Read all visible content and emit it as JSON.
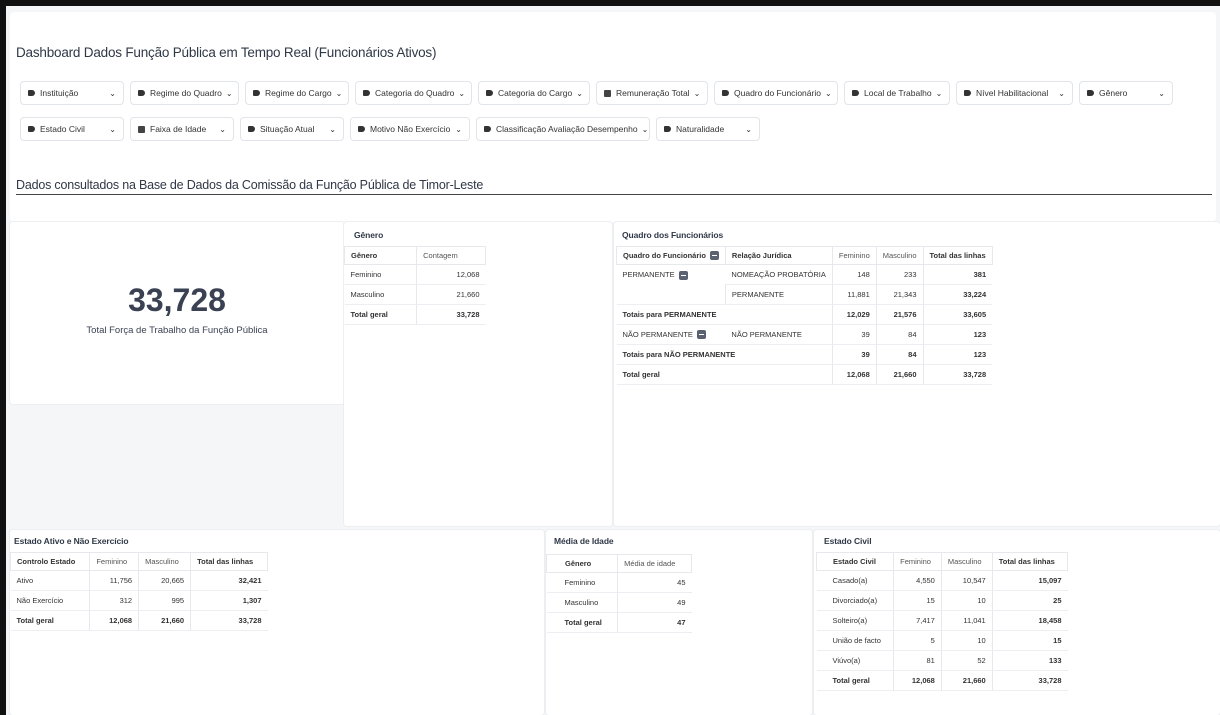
{
  "header": {
    "title": "Dashboard Dados Função Pública em Tempo Real (Funcionários Ativos)",
    "section_title": "Dados consultados na Base de Dados da Comissão da Função Pública de Timor-Leste"
  },
  "filters": [
    {
      "label": "Instituição",
      "icon": "tag-icon"
    },
    {
      "label": "Regime do Quadro",
      "icon": "tag-icon"
    },
    {
      "label": "Regime do Cargo",
      "icon": "tag-icon"
    },
    {
      "label": "Categoria do Quadro",
      "icon": "tag-icon"
    },
    {
      "label": "Categoria do Cargo",
      "icon": "tag-icon"
    },
    {
      "label": "Remuneração Total",
      "icon": "calendar-icon"
    },
    {
      "label": "Quadro do Funcionário",
      "icon": "tag-icon"
    },
    {
      "label": "Local de Trabalho",
      "icon": "tag-icon"
    },
    {
      "label": "Nível Habilitacional",
      "icon": "tag-icon"
    },
    {
      "label": "Gênero",
      "icon": "tag-icon"
    },
    {
      "label": "Estado Civil",
      "icon": "tag-icon"
    },
    {
      "label": "Faixa de Idade",
      "icon": "calendar-icon"
    },
    {
      "label": "Situação Atual",
      "icon": "tag-icon"
    },
    {
      "label": "Motivo Não Exercício",
      "icon": "tag-icon"
    },
    {
      "label": "Classificação Avaliação Desempenho",
      "icon": "tag-icon"
    },
    {
      "label": "Naturalidade",
      "icon": "tag-icon"
    }
  ],
  "kpi": {
    "value": "33,728",
    "label": "Total Força de Trabalho da Função Pública"
  },
  "genero": {
    "title": "Gênero",
    "headers": [
      "Gênero",
      "Contagem"
    ],
    "rows": [
      [
        "Feminino",
        "12,068"
      ],
      [
        "Masculino",
        "21,660"
      ],
      [
        "Total geral",
        "33,728"
      ]
    ]
  },
  "quadro": {
    "title": "Quadro dos Funcionários",
    "headers": [
      "Quadro do Funcionário",
      "Relação Jurídica",
      "Feminino",
      "Masculino",
      "Total das linhas"
    ],
    "rows": [
      [
        "PERMANENTE",
        "NOMEAÇÃO PROBATÓRIA",
        "148",
        "233",
        "381"
      ],
      [
        "",
        "PERMANENTE",
        "11,881",
        "21,343",
        "33,224"
      ],
      [
        "Totais para PERMANENTE",
        "",
        "12,029",
        "21,576",
        "33,605"
      ],
      [
        "NÃO PERMANENTE",
        "NÃO PERMANENTE",
        "39",
        "84",
        "123"
      ],
      [
        "Totais para NÃO PERMANENTE",
        "",
        "39",
        "84",
        "123"
      ],
      [
        "Total geral",
        "",
        "12,068",
        "21,660",
        "33,728"
      ]
    ]
  },
  "estado_ativo": {
    "title": "Estado Ativo e Não Exercício",
    "headers": [
      "Controlo Estado",
      "Feminino",
      "Masculino",
      "Total das linhas"
    ],
    "rows": [
      [
        "Ativo",
        "11,756",
        "20,665",
        "32,421"
      ],
      [
        "Não Exercício",
        "312",
        "995",
        "1,307"
      ],
      [
        "Total geral",
        "12,068",
        "21,660",
        "33,728"
      ]
    ]
  },
  "media_idade": {
    "title": "Média de Idade",
    "headers": [
      "Gênero",
      "Média de idade"
    ],
    "rows": [
      [
        "Feminino",
        "45"
      ],
      [
        "Masculino",
        "49"
      ],
      [
        "Total geral",
        "47"
      ]
    ]
  },
  "estado_civil": {
    "title": "Estado Civil",
    "headers": [
      "Estado Civil",
      "Feminino",
      "Masculino",
      "Total das linhas"
    ],
    "rows": [
      [
        "Casado(a)",
        "4,550",
        "10,547",
        "15,097"
      ],
      [
        "Divorciado(a)",
        "15",
        "10",
        "25"
      ],
      [
        "Solteiro(a)",
        "7,417",
        "11,041",
        "18,458"
      ],
      [
        "União de facto",
        "5",
        "10",
        "15"
      ],
      [
        "Viúvo(a)",
        "81",
        "52",
        "133"
      ],
      [
        "Total geral",
        "12,068",
        "21,660",
        "33,728"
      ]
    ]
  }
}
